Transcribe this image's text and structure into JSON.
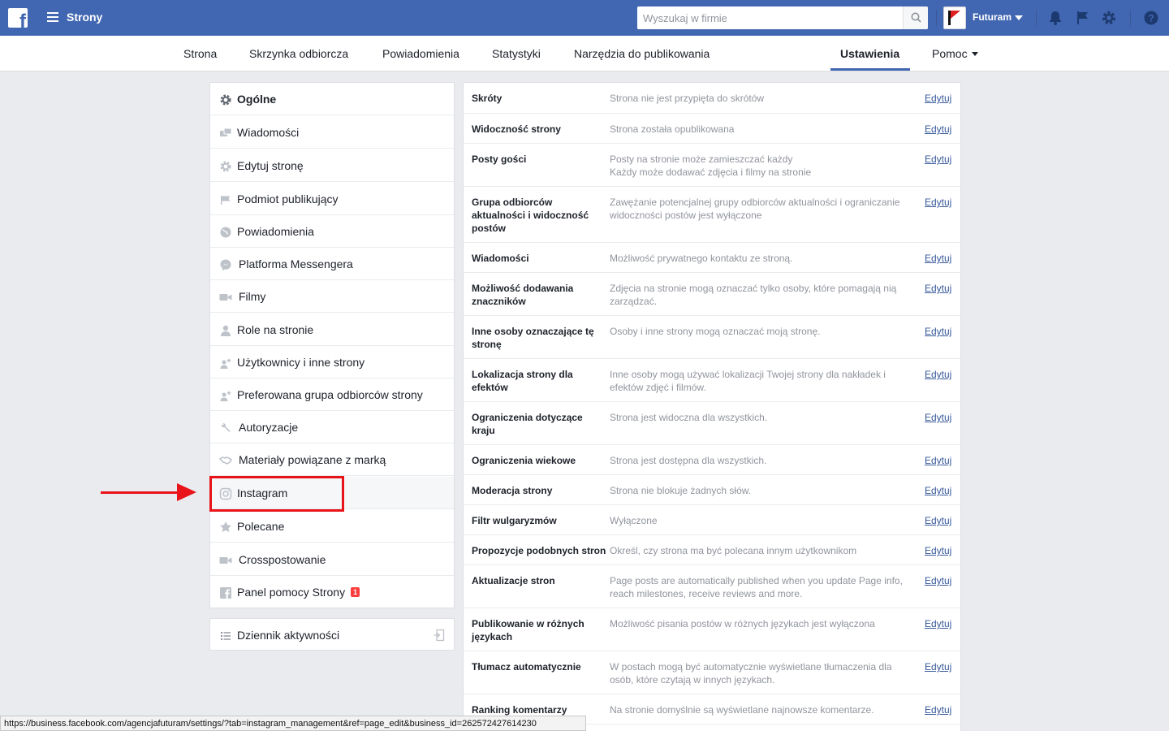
{
  "topbar": {
    "title": "Strony",
    "search_placeholder": "Wyszukaj w firmie",
    "profile_name": "Futuram"
  },
  "subnav": {
    "tabs": [
      {
        "label": "Strona"
      },
      {
        "label": "Skrzynka odbiorcza"
      },
      {
        "label": "Powiadomienia"
      },
      {
        "label": "Statystyki"
      },
      {
        "label": "Narzędzia do publikowania"
      },
      {
        "label": "Ustawienia",
        "active": true
      },
      {
        "label": "Pomoc"
      }
    ]
  },
  "sidebar": {
    "items": [
      {
        "label": "Ogólne",
        "icon": "gear-icon"
      },
      {
        "label": "Wiadomości",
        "icon": "messages-icon"
      },
      {
        "label": "Edytuj stronę",
        "icon": "gear-icon"
      },
      {
        "label": "Podmiot publikujący",
        "icon": "flag-icon"
      },
      {
        "label": "Powiadomienia",
        "icon": "globe-icon"
      },
      {
        "label": "Platforma Messengera",
        "icon": "messenger-icon"
      },
      {
        "label": "Filmy",
        "icon": "video-camera-icon"
      },
      {
        "label": "Role na stronie",
        "icon": "person-icon"
      },
      {
        "label": "Użytkownicy i inne strony",
        "icon": "person-star-icon"
      },
      {
        "label": "Preferowana grupa odbiorców strony",
        "icon": "person-star-icon"
      },
      {
        "label": "Autoryzacje",
        "icon": "wrench-icon"
      },
      {
        "label": "Materiały powiązane z marką",
        "icon": "handshake-icon"
      },
      {
        "label": "Instagram",
        "icon": "instagram-icon"
      },
      {
        "label": "Polecane",
        "icon": "star-icon"
      },
      {
        "label": "Crosspostowanie",
        "icon": "video-camera-icon"
      },
      {
        "label": "Panel pomocy Strony",
        "icon": "facebook-icon",
        "badge": "1"
      }
    ],
    "activity_log": "Dziennik aktywności"
  },
  "settings": {
    "edit_label": "Edytuj",
    "rows": [
      {
        "label": "Skróty",
        "desc": "Strona nie jest przypięta do skrótów"
      },
      {
        "label": "Widoczność strony",
        "desc": "Strona została opublikowana"
      },
      {
        "label": "Posty gości",
        "desc": "Posty na stronie może zamieszczać każdy\nKażdy może dodawać zdjęcia i filmy na stronie"
      },
      {
        "label": "Grupa odbiorców aktualności i widoczność postów",
        "desc": "Zawężanie potencjalnej grupy odbiorców aktualności i ograniczanie widoczności postów jest wyłączone"
      },
      {
        "label": "Wiadomości",
        "desc": "Możliwość prywatnego kontaktu ze stroną."
      },
      {
        "label": "Możliwość dodawania znaczników",
        "desc": "Zdjęcia na stronie mogą oznaczać tylko osoby, które pomagają nią zarządzać."
      },
      {
        "label": "Inne osoby oznaczające tę stronę",
        "desc": "Osoby i inne strony mogą oznaczać moją stronę."
      },
      {
        "label": "Lokalizacja strony dla efektów",
        "desc": "Inne osoby mogą używać lokalizacji Twojej strony dla nakładek i efektów zdjęć i filmów."
      },
      {
        "label": "Ograniczenia dotyczące kraju",
        "desc": "Strona jest widoczna dla wszystkich."
      },
      {
        "label": "Ograniczenia wiekowe",
        "desc": "Strona jest dostępna dla wszystkich."
      },
      {
        "label": "Moderacja strony",
        "desc": "Strona nie blokuje żadnych słów."
      },
      {
        "label": "Filtr wulgaryzmów",
        "desc": "Wyłączone"
      },
      {
        "label": "Propozycje podobnych stron",
        "desc": "Określ, czy strona ma być polecana innym użytkownikom"
      },
      {
        "label": "Aktualizacje stron",
        "desc": "Page posts are automatically published when you update Page info, reach milestones, receive reviews and more."
      },
      {
        "label": "Publikowanie w różnych językach",
        "desc": "Możliwość pisania postów w różnych językach jest wyłączona"
      },
      {
        "label": "Tłumacz automatycznie",
        "desc": "W postach mogą być automatycznie wyświetlane tłumaczenia dla osób, które czytają w innych językach."
      },
      {
        "label": "Ranking komentarzy",
        "desc": "Na stronie domyślnie są wyświetlane najnowsze komentarze."
      }
    ]
  },
  "statusbar": {
    "url": "https://business.facebook.com/agencjafuturam/settings/?tab=instagram_management&ref=page_edit&business_id=262572427614230"
  },
  "colors": {
    "topbar": "#4267b2",
    "link": "#365899",
    "annotation": "#e8141a",
    "badge": "#fa3e3e"
  }
}
